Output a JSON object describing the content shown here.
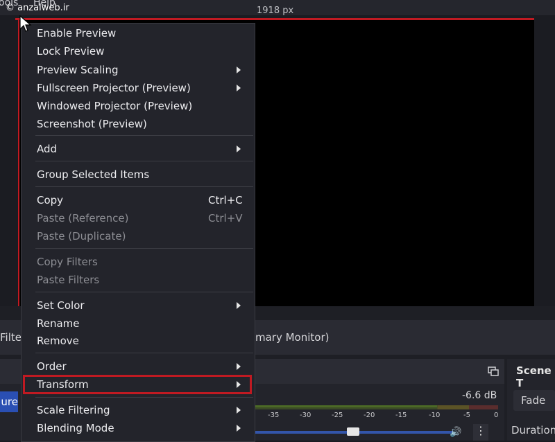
{
  "menubar": {
    "tools": "ools",
    "help": "Help"
  },
  "watermark": "© anzalweb.ir",
  "preview_label": "1918 px",
  "context_menu": {
    "enable_preview": "Enable Preview",
    "lock_preview": "Lock Preview",
    "preview_scaling": "Preview Scaling",
    "fullscreen_projector": "Fullscreen Projector (Preview)",
    "windowed_projector": "Windowed Projector (Preview)",
    "screenshot": "Screenshot (Preview)",
    "add": "Add",
    "group_selected": "Group Selected Items",
    "copy": "Copy",
    "copy_shortcut": "Ctrl+C",
    "paste_reference": "Paste (Reference)",
    "paste_reference_shortcut": "Ctrl+V",
    "paste_duplicate": "Paste (Duplicate)",
    "copy_filters": "Copy Filters",
    "paste_filters": "Paste Filters",
    "set_color": "Set Color",
    "rename": "Rename",
    "remove": "Remove",
    "order": "Order",
    "transform": "Transform",
    "scale_filtering": "Scale Filtering",
    "blending_mode": "Blending Mode"
  },
  "bottom": {
    "filters_fragment": "Filte",
    "monitor_fragment": "mary Monitor)",
    "source_fragment": "ure",
    "db_value": "-6.6 dB",
    "ticks": [
      "-35",
      "-30",
      "-25",
      "-20",
      "-15",
      "-10",
      "-5",
      "0"
    ],
    "scene_transitions_fragment": "Scene T",
    "fade": "Fade",
    "duration_fragment": "Duration"
  },
  "colors": {
    "highlight": "#c01a22",
    "accent": "#2a4fb3"
  }
}
